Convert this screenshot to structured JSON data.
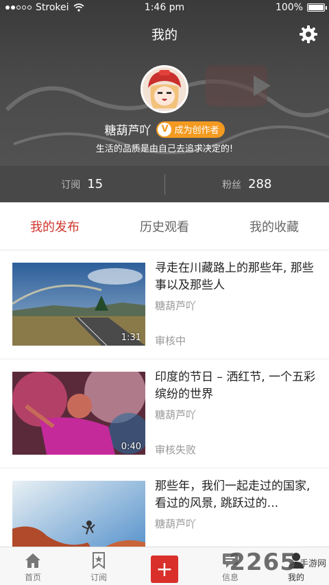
{
  "status_bar": {
    "carrier": "Strokei",
    "time": "1:46 pm",
    "battery": "100%"
  },
  "header": {
    "title": "我的",
    "username": "糖葫芦吖",
    "creator_badge_letter": "V",
    "creator_badge": "成为创作者",
    "signature": "生活的品质是由自己去追求决定的!"
  },
  "stats": {
    "subscribe_label": "订阅",
    "subscribe_value": "15",
    "fans_label": "粉丝",
    "fans_value": "288"
  },
  "tabs": [
    {
      "label": "我的发布",
      "active": true
    },
    {
      "label": "历史观看",
      "active": false
    },
    {
      "label": "我的收藏",
      "active": false
    }
  ],
  "items": [
    {
      "title": "寻走在川藏路上的那些年, 那些事以及那些人",
      "author": "糖葫芦吖",
      "status": "审核中",
      "duration": "1:31"
    },
    {
      "title": "印度的节日 – 洒红节, 一个五彩缤纷的世界",
      "author": "糖葫芦吖",
      "status": "审核失败",
      "duration": "0:40"
    },
    {
      "title": "那些年，我们一起走过的国家, 看过的风景, 跳跃过的...",
      "author": "糖葫芦吖",
      "status": "",
      "duration": ""
    }
  ],
  "bottom_nav": [
    {
      "label": "首页",
      "icon": "home-icon"
    },
    {
      "label": "订阅",
      "icon": "bookmark-star-icon"
    },
    {
      "label": "",
      "icon": "add-icon"
    },
    {
      "label": "信息",
      "icon": "message-icon"
    },
    {
      "label": "我的",
      "icon": "person-icon"
    }
  ],
  "watermark": {
    "number": "2265",
    "site": "手游网"
  },
  "colors": {
    "accent": "#d0342c",
    "badge": "#f39a21",
    "header_bg": "#444444"
  }
}
